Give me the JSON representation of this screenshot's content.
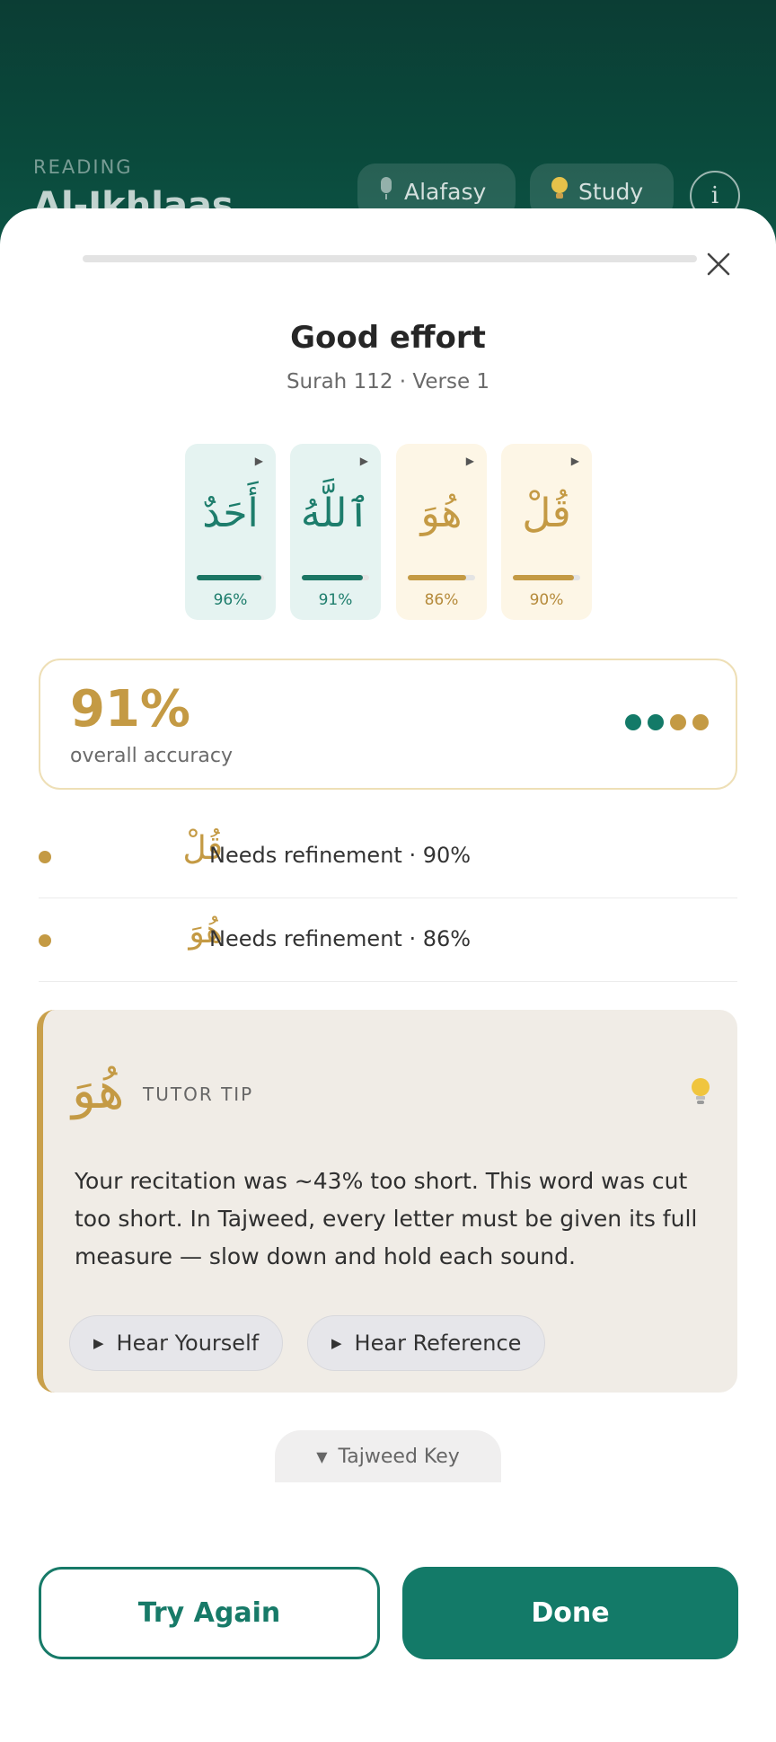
{
  "background": {
    "label": "READING",
    "title": "Al-Ikhlaas",
    "reciter_chip": "Alafasy",
    "study_chip": "Study"
  },
  "result": {
    "heading": "Good effort",
    "subheading": "Surah 112 · Verse 1"
  },
  "words": [
    {
      "arabic": "أَحَدٌ",
      "score": "96%",
      "fill": 0.96,
      "status": "good"
    },
    {
      "arabic": "ٱللَّهُ",
      "score": "91%",
      "fill": 0.91,
      "status": "good"
    },
    {
      "arabic": "هُوَ",
      "score": "86%",
      "fill": 0.86,
      "status": "needs-work"
    },
    {
      "arabic": "قُلْ",
      "score": "90%",
      "fill": 0.9,
      "status": "needs-work"
    }
  ],
  "accuracy": {
    "value": "91%",
    "label": "overall accuracy",
    "dot_colors": [
      "#137a68",
      "#137a68",
      "#c49a44",
      "#c49a44"
    ]
  },
  "issues": [
    {
      "arabic": "قُلْ",
      "text": "Needs refinement · 90%"
    },
    {
      "arabic": "هُوَ",
      "text": "Needs refinement · 86%"
    }
  ],
  "tip": {
    "arabic": "هُوَ",
    "label": "TUTOR TIP",
    "body": "Your recitation was ~43% too short. This word was cut too short. In Tajweed, every letter must be given its full measure — slow down and hold each sound.",
    "hear_yourself": "Hear Yourself",
    "hear_reference": "Hear Reference"
  },
  "tajweed_key": "Tajweed Key",
  "actions": {
    "try_again": "Try Again",
    "done": "Done"
  },
  "colors": {
    "primary": "#137a68",
    "accent": "#c49a44"
  }
}
